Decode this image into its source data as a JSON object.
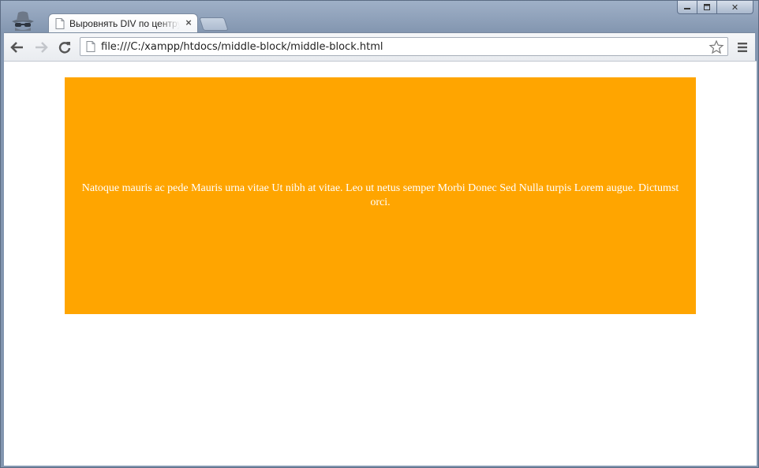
{
  "tab": {
    "title": "Выровнять DIV по центру",
    "close": "×"
  },
  "toolbar": {
    "url": "file:///C:/xampp/htdocs/middle-block/middle-block.html"
  },
  "window_controls": {
    "minimize": "",
    "maximize": "",
    "close": "✕"
  },
  "page": {
    "block_text": "Natoque mauris ac pede Mauris urna vitae Ut nibh at vitae. Leo ut netus semper Morbi Donec Sed Nulla turpis Lorem augue. Dictumst orci.",
    "block_color": "#ffa500",
    "text_color": "#ffffff"
  }
}
